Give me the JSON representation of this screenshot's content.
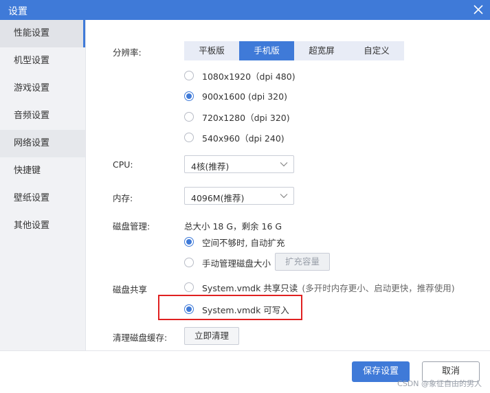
{
  "window": {
    "title": "设置",
    "close_icon": "close-icon"
  },
  "sidebar": {
    "items": [
      {
        "label": "性能设置"
      },
      {
        "label": "机型设置"
      },
      {
        "label": "游戏设置"
      },
      {
        "label": "音频设置"
      },
      {
        "label": "网络设置"
      },
      {
        "label": "快捷键"
      },
      {
        "label": "壁纸设置"
      },
      {
        "label": "其他设置"
      }
    ],
    "active_index": 0
  },
  "resolution": {
    "label": "分辨率:",
    "tabs": [
      "平板版",
      "手机版",
      "超宽屏",
      "自定义"
    ],
    "active_tab": 1,
    "options": [
      {
        "text": "1080x1920（dpi 480)",
        "selected": false
      },
      {
        "text": "900x1600 (dpi 320)",
        "selected": true
      },
      {
        "text": "720x1280（dpi 320)",
        "selected": false
      },
      {
        "text": "540x960（dpi 240)",
        "selected": false
      }
    ]
  },
  "cpu": {
    "label": "CPU:",
    "value": "4核(推荐)"
  },
  "memory": {
    "label": "内存:",
    "value": "4096M(推荐)"
  },
  "disk": {
    "label": "磁盘管理:",
    "summary": "总大小 18 G，剩余 16 G",
    "options": [
      {
        "text": "空间不够时, 自动扩充",
        "selected": true
      },
      {
        "text": "手动管理磁盘大小",
        "selected": false
      }
    ],
    "expand_button": "扩充容量"
  },
  "disk_share": {
    "label": "磁盘共享",
    "options": [
      {
        "text": "System.vmdk 共享只读",
        "note": "(多开时内存更小、启动更快，推荐使用)",
        "selected": false
      },
      {
        "text": "System.vmdk 可写入",
        "note": "",
        "selected": true
      }
    ]
  },
  "cache": {
    "label": "清理磁盘缓存:",
    "button": "立即清理"
  },
  "footer": {
    "save": "保存设置",
    "cancel": "取消"
  },
  "watermark": "CSDN @象征自由的男人",
  "colors": {
    "accent": "#3f7ad8",
    "highlight": "#e02020"
  }
}
